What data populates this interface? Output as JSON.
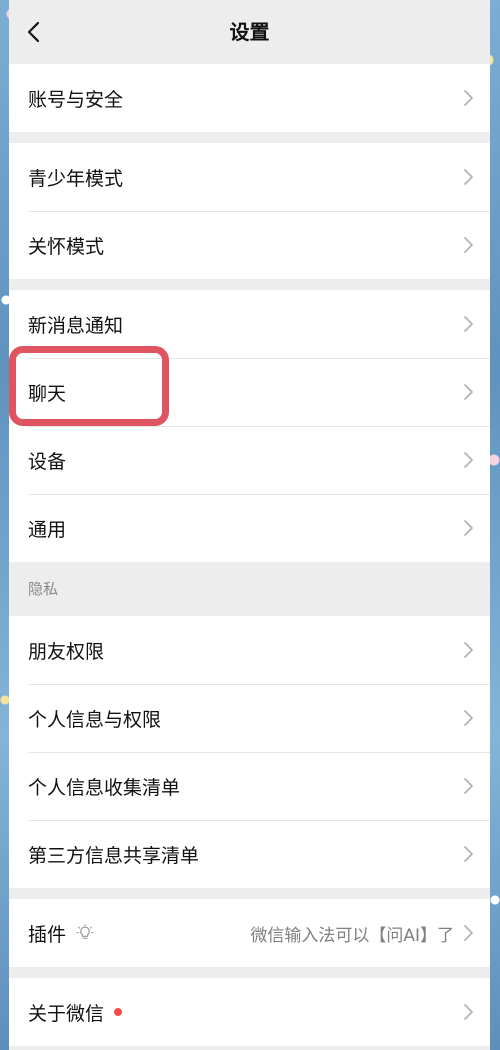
{
  "nav": {
    "title": "设置",
    "back_icon": "chevron-left-icon"
  },
  "groups": {
    "account": {
      "items": [
        {
          "label": "账号与安全"
        }
      ]
    },
    "modes": {
      "items": [
        {
          "label": "青少年模式"
        },
        {
          "label": "关怀模式"
        }
      ]
    },
    "general": {
      "items": [
        {
          "label": "新消息通知"
        },
        {
          "label": "聊天"
        },
        {
          "label": "设备"
        },
        {
          "label": "通用"
        }
      ]
    },
    "privacy": {
      "header": "隐私",
      "items": [
        {
          "label": "朋友权限"
        },
        {
          "label": "个人信息与权限"
        },
        {
          "label": "个人信息收集清单"
        },
        {
          "label": "第三方信息共享清单"
        }
      ]
    },
    "plugins": {
      "items": [
        {
          "label": "插件",
          "icon": "bulb-icon",
          "detail": "微信输入法可以【问AI】了"
        }
      ]
    },
    "about": {
      "items": [
        {
          "label": "关于微信",
          "badge": "red-dot"
        }
      ]
    }
  },
  "annotation": {
    "highlighted_item": "聊天",
    "color": "#de5460"
  },
  "colors": {
    "page_bg": "#ededed",
    "row_bg": "#ffffff",
    "text": "#111111",
    "secondary_text": "#808080",
    "badge": "#f24a4a"
  }
}
